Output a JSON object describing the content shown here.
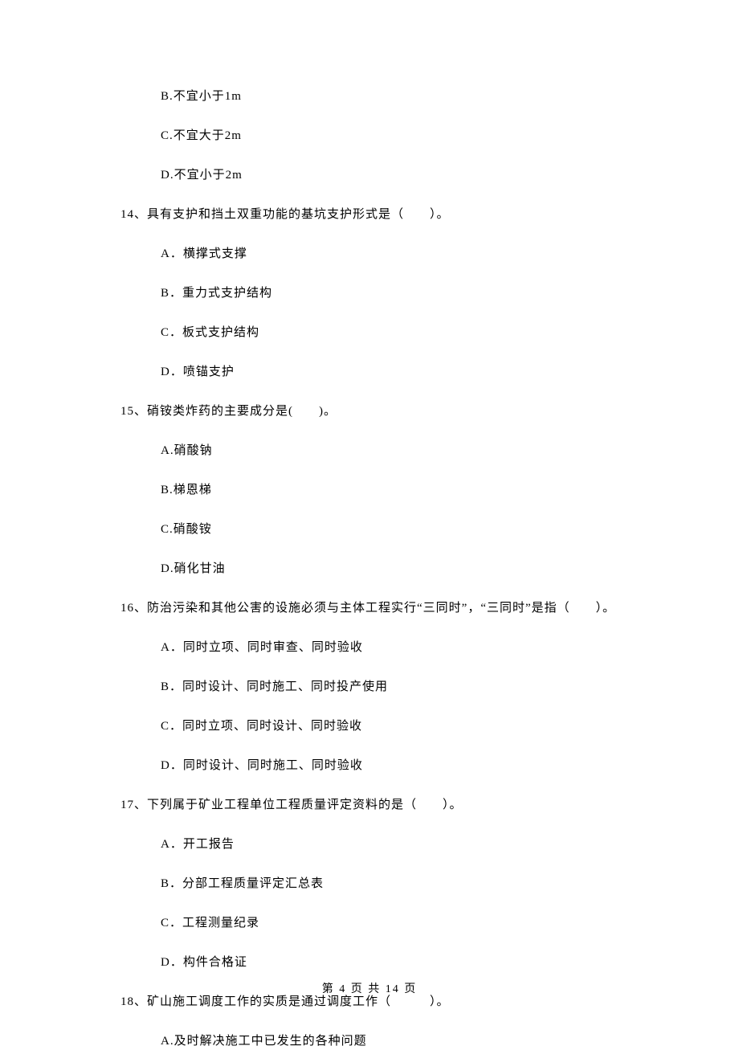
{
  "q13": {
    "options": {
      "b": "B.不宜小于1m",
      "c": "C.不宜大于2m",
      "d": "D.不宜小于2m"
    }
  },
  "q14": {
    "stem": "14、具有支护和挡土双重功能的基坑支护形式是（　　）。",
    "options": {
      "a": "A．横撑式支撑",
      "b": "B．重力式支护结构",
      "c": "C．板式支护结构",
      "d": "D．喷锚支护"
    }
  },
  "q15": {
    "stem": "15、硝铵类炸药的主要成分是(　　)。",
    "options": {
      "a": "A.硝酸钠",
      "b": "B.梯恩梯",
      "c": "C.硝酸铵",
      "d": "D.硝化甘油"
    }
  },
  "q16": {
    "stem": "16、防治污染和其他公害的设施必须与主体工程实行“三同时”，“三同时”是指（　　）。",
    "options": {
      "a": "A．同时立项、同时审查、同时验收",
      "b": "B．同时设计、同时施工、同时投产使用",
      "c": "C．同时立项、同时设计、同时验收",
      "d": "D．同时设计、同时施工、同时验收"
    }
  },
  "q17": {
    "stem": "17、下列属于矿业工程单位工程质量评定资料的是（　　）。",
    "options": {
      "a": "A．开工报告",
      "b": "B．分部工程质量评定汇总表",
      "c": "C．工程测量纪录",
      "d": "D．构件合格证"
    }
  },
  "q18": {
    "stem": "18、矿山施工调度工作的实质是通过调度工作（　　　）。",
    "options": {
      "a": "A.及时解决施工中已发生的各种问题"
    }
  },
  "footer": "第 4 页 共 14 页"
}
